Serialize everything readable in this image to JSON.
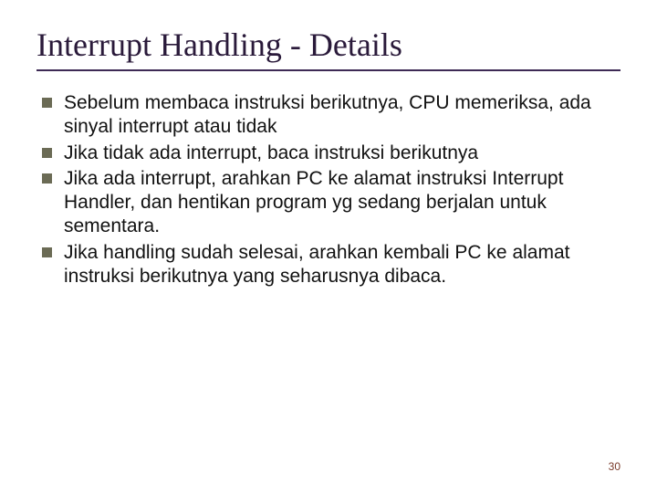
{
  "title": "Interrupt Handling - Details",
  "bullets": [
    "Sebelum membaca instruksi berikutnya, CPU memeriksa, ada sinyal interrupt atau tidak",
    "Jika tidak ada interrupt, baca instruksi berikutnya",
    "Jika ada interrupt, arahkan PC ke alamat instruksi Interrupt Handler, dan hentikan program yg sedang berjalan untuk sementara.",
    "Jika handling sudah selesai, arahkan kembali PC ke alamat instruksi berikutnya yang seharusnya dibaca."
  ],
  "page_number": "30"
}
